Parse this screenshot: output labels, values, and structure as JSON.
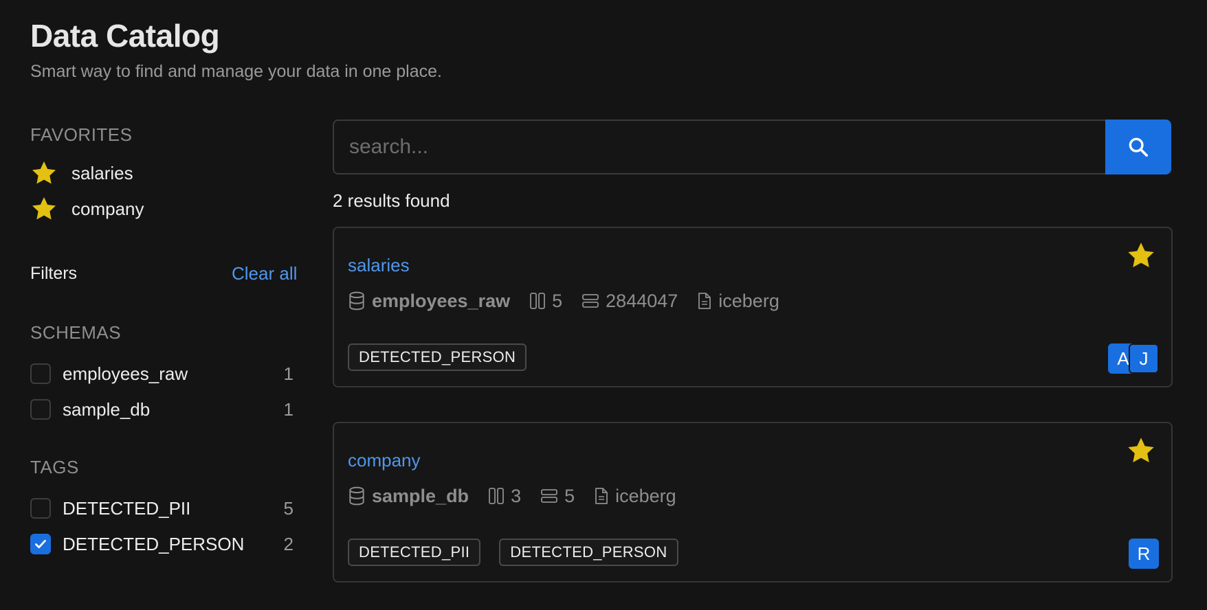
{
  "header": {
    "title": "Data Catalog",
    "subtitle": "Smart way to find and manage your data in one place."
  },
  "sidebar": {
    "favorites_heading": "FAVORITES",
    "favorites": [
      {
        "label": "salaries",
        "icon": "star-icon"
      },
      {
        "label": "company",
        "icon": "star-icon"
      }
    ],
    "filters_label": "Filters",
    "clear_all_label": "Clear all",
    "schemas_heading": "SCHEMAS",
    "schemas": [
      {
        "label": "employees_raw",
        "count": "1",
        "checked": false
      },
      {
        "label": "sample_db",
        "count": "1",
        "checked": false
      }
    ],
    "tags_heading": "TAGS",
    "tags": [
      {
        "label": "DETECTED_PII",
        "count": "5",
        "checked": false
      },
      {
        "label": "DETECTED_PERSON",
        "count": "2",
        "checked": true
      }
    ]
  },
  "search": {
    "placeholder": "search...",
    "value": "",
    "button_icon": "search-icon"
  },
  "results": {
    "count_text": "2 results found",
    "items": [
      {
        "title": "salaries",
        "favorite": true,
        "database": "employees_raw",
        "columns": "5",
        "rows": "2844047",
        "format": "iceberg",
        "tags": [
          "DETECTED_PERSON"
        ],
        "owners": [
          "A",
          "J"
        ]
      },
      {
        "title": "company",
        "favorite": true,
        "database": "sample_db",
        "columns": "3",
        "rows": "5",
        "format": "iceberg",
        "tags": [
          "DETECTED_PII",
          "DETECTED_PERSON"
        ],
        "owners": [
          "R"
        ]
      }
    ]
  },
  "colors": {
    "background": "#141414",
    "accent": "#1a6fe0",
    "link": "#4f97ec",
    "star": "#e3c012",
    "muted": "#8e8e8e"
  }
}
